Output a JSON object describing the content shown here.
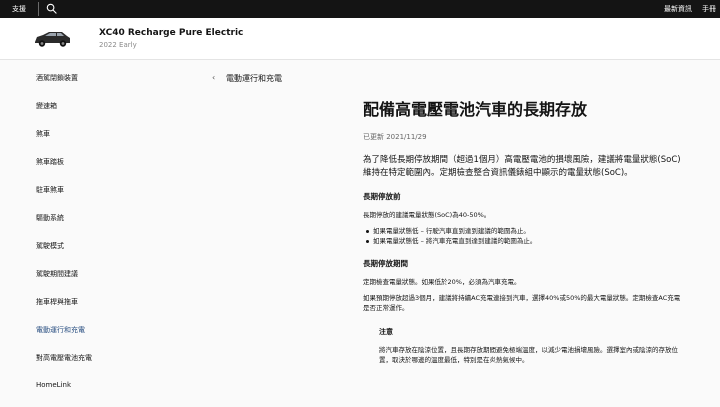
{
  "topbar": {
    "support_label": "支援",
    "latest_news_label": "最新資訊",
    "manual_label": "手冊"
  },
  "car": {
    "title": "XC40 Recharge Pure Electric",
    "year": "2022 Early"
  },
  "sidebar": {
    "items": [
      {
        "label": "酒駕閉鎖裝置"
      },
      {
        "label": "變速箱"
      },
      {
        "label": "煞車"
      },
      {
        "label": "煞車踏板"
      },
      {
        "label": "駐車煞車"
      },
      {
        "label": "驅動系統"
      },
      {
        "label": "駕駛模式"
      },
      {
        "label": "駕駛期間建議"
      },
      {
        "label": "拖車桿與拖車"
      },
      {
        "label": "電動運行和充電"
      },
      {
        "label": "對高電壓電池充電"
      },
      {
        "label": "HomeLink"
      }
    ],
    "active_index": 9
  },
  "breadcrumb": {
    "back_glyph": "‹",
    "label": "電動運行和充電"
  },
  "article": {
    "title": "配備高電壓電池汽車的長期存放",
    "updated": "已更新 2021/11/29",
    "intro": "為了降低長期停放期間（超過1個月）高電壓電池的損壞風險，建議將電量狀態(SoC)維持在特定範圍內。定期檢查整合資訊儀錶組中顯示的電量狀態(SoC)。",
    "section1": {
      "heading": "長期停放前",
      "text": "長期停放的建議電量狀態(SoC)為40-50%。",
      "bullets": [
        "如果電量狀態低 – 行駛汽車直到達到建議的範圍為止。",
        "如果電量狀態低 – 將汽車充電直到達到建議的範圍為止。"
      ]
    },
    "section2": {
      "heading": "長期停放期間",
      "text1": "定期檢查電量狀態。如果低於20%，必須為汽車充電。",
      "text2": "如果預期停放超過3個月，建議將持續AC充電連接到汽車，選擇40%或50%的最大電量狀態。定期檢查AC充電是否正常運作。"
    },
    "note": {
      "title": "注意",
      "text": "將汽車存放在陰涼位置，且長期存放期間避免極端溫度，以減少電池損壞風險。選擇室內或陰涼的存放位置，取決於哪邊的溫度最低，特別是在炎熱氣候中。"
    }
  },
  "colors": {
    "topbar_bg": "#141414",
    "active_link": "#284e80",
    "content_bg": "#fafafa"
  },
  "icons": {
    "search": "search-icon",
    "car": "car-thumbnail",
    "back": "chevron-left-icon"
  }
}
